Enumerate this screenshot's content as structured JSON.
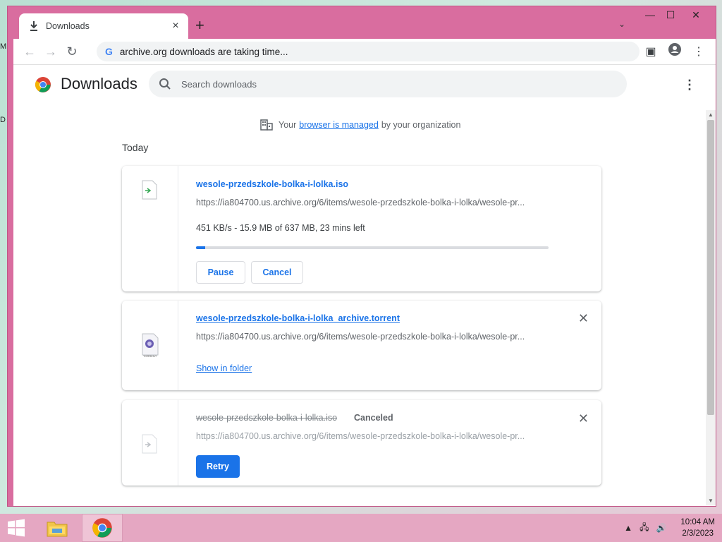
{
  "desktop": {
    "frag1": "M",
    "frag2": "D"
  },
  "tab": {
    "title": "Downloads",
    "close": "×"
  },
  "window_controls": {
    "new_tab": "+",
    "minimize": "—",
    "maximize": "☐",
    "close": "✕",
    "tab_search": "⌄"
  },
  "address_bar": {
    "url": "archive.org downloads are taking time..."
  },
  "page": {
    "title": "Downloads",
    "search_placeholder": "Search downloads",
    "managed_prefix": "Your",
    "managed_link": "browser is managed",
    "managed_suffix": "by your organization",
    "section_today": "Today"
  },
  "downloads": [
    {
      "filename": "wesole-przedszkole-bolka-i-lolka.iso",
      "source": "https://ia804700.us.archive.org/6/items/wesole-przedszkole-bolka-i-lolka/wesole-pr...",
      "progress_text": "451 KB/s - 15.9 MB of 637 MB, 23 mins left",
      "progress_fraction": 0.025,
      "pause_label": "Pause",
      "cancel_label": "Cancel"
    },
    {
      "filename": "wesole-przedszkole-bolka-i-lolka_archive.torrent",
      "source": "https://ia804700.us.archive.org/6/items/wesole-przedszkole-bolka-i-lolka/wesole-pr...",
      "show_in_folder": "Show in folder",
      "icon_label": "TORRENT"
    },
    {
      "filename": "wesole-przedszkole-bolka-i-lolka.iso",
      "status": "Canceled",
      "source": "https://ia804700.us.archive.org/6/items/wesole-przedszkole-bolka-i-lolka/wesole-pr...",
      "retry_label": "Retry"
    }
  ],
  "taskbar": {
    "time": "10:04 AM",
    "date": "2/3/2023"
  },
  "colors": {
    "accent": "#1a73e8",
    "frame": "#d96d9f"
  }
}
